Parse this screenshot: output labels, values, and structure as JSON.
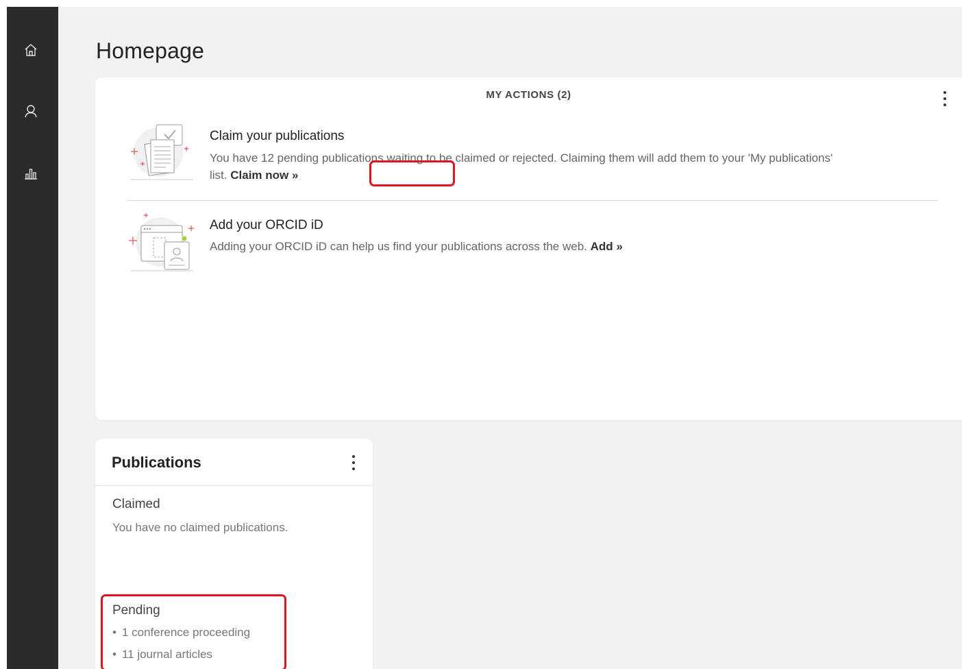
{
  "nav": {
    "items": [
      {
        "icon": "home-icon"
      },
      {
        "icon": "user-icon"
      },
      {
        "icon": "bar-chart-icon"
      }
    ]
  },
  "page": {
    "title": "Homepage"
  },
  "my_actions": {
    "header": "MY ACTIONS (2)",
    "items": [
      {
        "title": "Claim your publications",
        "desc": "You have 12 pending publications waiting to be claimed or rejected. Claiming them will add them to your 'My publications' list. ",
        "link": "Claim now »",
        "icon": "claim-publications-illustration"
      },
      {
        "title": "Add your ORCID iD",
        "desc": "Adding your ORCID iD can help us find your publications across the web. ",
        "link": "Add »",
        "icon": "orcid-illustration"
      }
    ]
  },
  "publications": {
    "title": "Publications",
    "claimed": {
      "title": "Claimed",
      "text": "You have no claimed publications."
    },
    "pending": {
      "title": "Pending",
      "items": [
        "1 conference proceeding",
        "11 journal articles"
      ]
    }
  },
  "colors": {
    "sidebar": "#2b2b2b",
    "background": "#f2f2f2",
    "highlight": "#e0141e",
    "accent_star": "#e05555"
  }
}
